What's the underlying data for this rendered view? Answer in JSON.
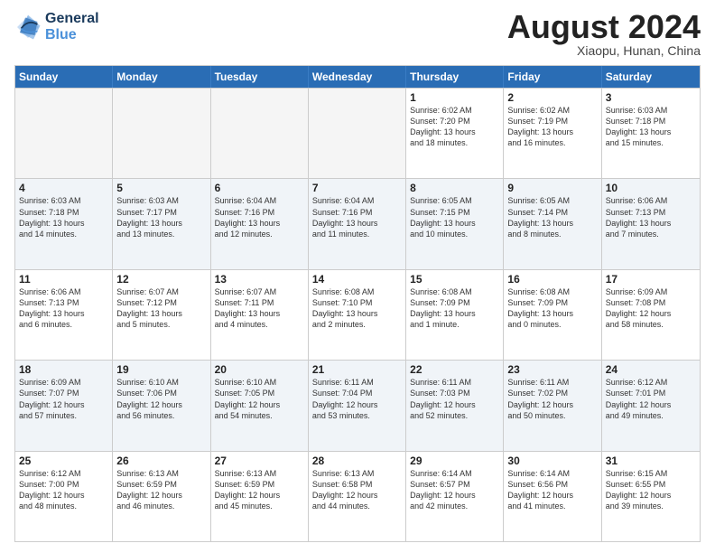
{
  "logo": {
    "line1": "General",
    "line2": "Blue"
  },
  "title": "August 2024",
  "subtitle": "Xiaopu, Hunan, China",
  "header_days": [
    "Sunday",
    "Monday",
    "Tuesday",
    "Wednesday",
    "Thursday",
    "Friday",
    "Saturday"
  ],
  "rows": [
    [
      {
        "day": "",
        "info": ""
      },
      {
        "day": "",
        "info": ""
      },
      {
        "day": "",
        "info": ""
      },
      {
        "day": "",
        "info": ""
      },
      {
        "day": "1",
        "info": "Sunrise: 6:02 AM\nSunset: 7:20 PM\nDaylight: 13 hours\nand 18 minutes."
      },
      {
        "day": "2",
        "info": "Sunrise: 6:02 AM\nSunset: 7:19 PM\nDaylight: 13 hours\nand 16 minutes."
      },
      {
        "day": "3",
        "info": "Sunrise: 6:03 AM\nSunset: 7:18 PM\nDaylight: 13 hours\nand 15 minutes."
      }
    ],
    [
      {
        "day": "4",
        "info": "Sunrise: 6:03 AM\nSunset: 7:18 PM\nDaylight: 13 hours\nand 14 minutes."
      },
      {
        "day": "5",
        "info": "Sunrise: 6:03 AM\nSunset: 7:17 PM\nDaylight: 13 hours\nand 13 minutes."
      },
      {
        "day": "6",
        "info": "Sunrise: 6:04 AM\nSunset: 7:16 PM\nDaylight: 13 hours\nand 12 minutes."
      },
      {
        "day": "7",
        "info": "Sunrise: 6:04 AM\nSunset: 7:16 PM\nDaylight: 13 hours\nand 11 minutes."
      },
      {
        "day": "8",
        "info": "Sunrise: 6:05 AM\nSunset: 7:15 PM\nDaylight: 13 hours\nand 10 minutes."
      },
      {
        "day": "9",
        "info": "Sunrise: 6:05 AM\nSunset: 7:14 PM\nDaylight: 13 hours\nand 8 minutes."
      },
      {
        "day": "10",
        "info": "Sunrise: 6:06 AM\nSunset: 7:13 PM\nDaylight: 13 hours\nand 7 minutes."
      }
    ],
    [
      {
        "day": "11",
        "info": "Sunrise: 6:06 AM\nSunset: 7:13 PM\nDaylight: 13 hours\nand 6 minutes."
      },
      {
        "day": "12",
        "info": "Sunrise: 6:07 AM\nSunset: 7:12 PM\nDaylight: 13 hours\nand 5 minutes."
      },
      {
        "day": "13",
        "info": "Sunrise: 6:07 AM\nSunset: 7:11 PM\nDaylight: 13 hours\nand 4 minutes."
      },
      {
        "day": "14",
        "info": "Sunrise: 6:08 AM\nSunset: 7:10 PM\nDaylight: 13 hours\nand 2 minutes."
      },
      {
        "day": "15",
        "info": "Sunrise: 6:08 AM\nSunset: 7:09 PM\nDaylight: 13 hours\nand 1 minute."
      },
      {
        "day": "16",
        "info": "Sunrise: 6:08 AM\nSunset: 7:09 PM\nDaylight: 13 hours\nand 0 minutes."
      },
      {
        "day": "17",
        "info": "Sunrise: 6:09 AM\nSunset: 7:08 PM\nDaylight: 12 hours\nand 58 minutes."
      }
    ],
    [
      {
        "day": "18",
        "info": "Sunrise: 6:09 AM\nSunset: 7:07 PM\nDaylight: 12 hours\nand 57 minutes."
      },
      {
        "day": "19",
        "info": "Sunrise: 6:10 AM\nSunset: 7:06 PM\nDaylight: 12 hours\nand 56 minutes."
      },
      {
        "day": "20",
        "info": "Sunrise: 6:10 AM\nSunset: 7:05 PM\nDaylight: 12 hours\nand 54 minutes."
      },
      {
        "day": "21",
        "info": "Sunrise: 6:11 AM\nSunset: 7:04 PM\nDaylight: 12 hours\nand 53 minutes."
      },
      {
        "day": "22",
        "info": "Sunrise: 6:11 AM\nSunset: 7:03 PM\nDaylight: 12 hours\nand 52 minutes."
      },
      {
        "day": "23",
        "info": "Sunrise: 6:11 AM\nSunset: 7:02 PM\nDaylight: 12 hours\nand 50 minutes."
      },
      {
        "day": "24",
        "info": "Sunrise: 6:12 AM\nSunset: 7:01 PM\nDaylight: 12 hours\nand 49 minutes."
      }
    ],
    [
      {
        "day": "25",
        "info": "Sunrise: 6:12 AM\nSunset: 7:00 PM\nDaylight: 12 hours\nand 48 minutes."
      },
      {
        "day": "26",
        "info": "Sunrise: 6:13 AM\nSunset: 6:59 PM\nDaylight: 12 hours\nand 46 minutes."
      },
      {
        "day": "27",
        "info": "Sunrise: 6:13 AM\nSunset: 6:59 PM\nDaylight: 12 hours\nand 45 minutes."
      },
      {
        "day": "28",
        "info": "Sunrise: 6:13 AM\nSunset: 6:58 PM\nDaylight: 12 hours\nand 44 minutes."
      },
      {
        "day": "29",
        "info": "Sunrise: 6:14 AM\nSunset: 6:57 PM\nDaylight: 12 hours\nand 42 minutes."
      },
      {
        "day": "30",
        "info": "Sunrise: 6:14 AM\nSunset: 6:56 PM\nDaylight: 12 hours\nand 41 minutes."
      },
      {
        "day": "31",
        "info": "Sunrise: 6:15 AM\nSunset: 6:55 PM\nDaylight: 12 hours\nand 39 minutes."
      }
    ]
  ]
}
